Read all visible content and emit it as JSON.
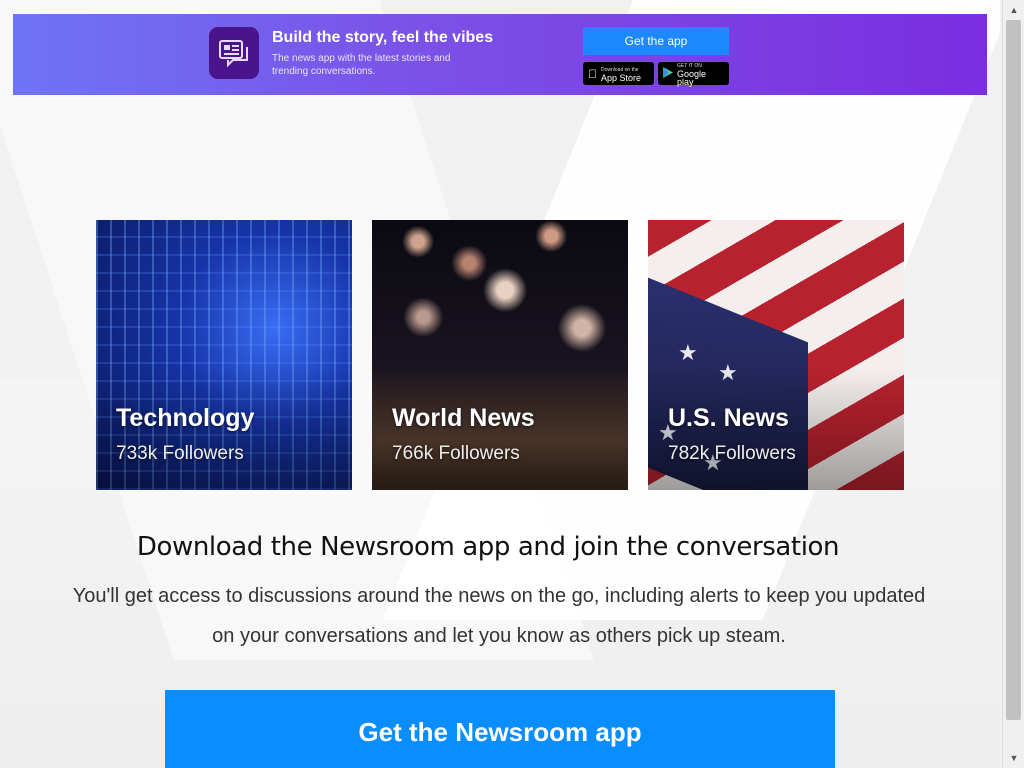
{
  "banner": {
    "title": "Build the story, feel the vibes",
    "subtitle": "The news app with the latest stories and trending conversations.",
    "get_app_label": "Get the app",
    "app_store": {
      "small": "Download on the",
      "big": "App Store"
    },
    "google_play": {
      "small": "GET IT ON",
      "big": "Google play"
    },
    "gradient": [
      "#6e74f4",
      "#7a2ee0"
    ]
  },
  "topics": [
    {
      "name": "Technology",
      "followers": "733k Followers"
    },
    {
      "name": "World News",
      "followers": "766k Followers"
    },
    {
      "name": "U.S. News",
      "followers": "782k Followers"
    }
  ],
  "download": {
    "title": "Download the Newsroom app and join the conversation",
    "description": "You'll get access to discussions around the news on the go, including alerts to keep you updated on your conversations and let you know as others pick up steam.",
    "cta_label": "Get the Newsroom app",
    "cta_color": "#0a8dff"
  },
  "scrollbar": {
    "up_icon": "▲",
    "down_icon": "▼"
  }
}
